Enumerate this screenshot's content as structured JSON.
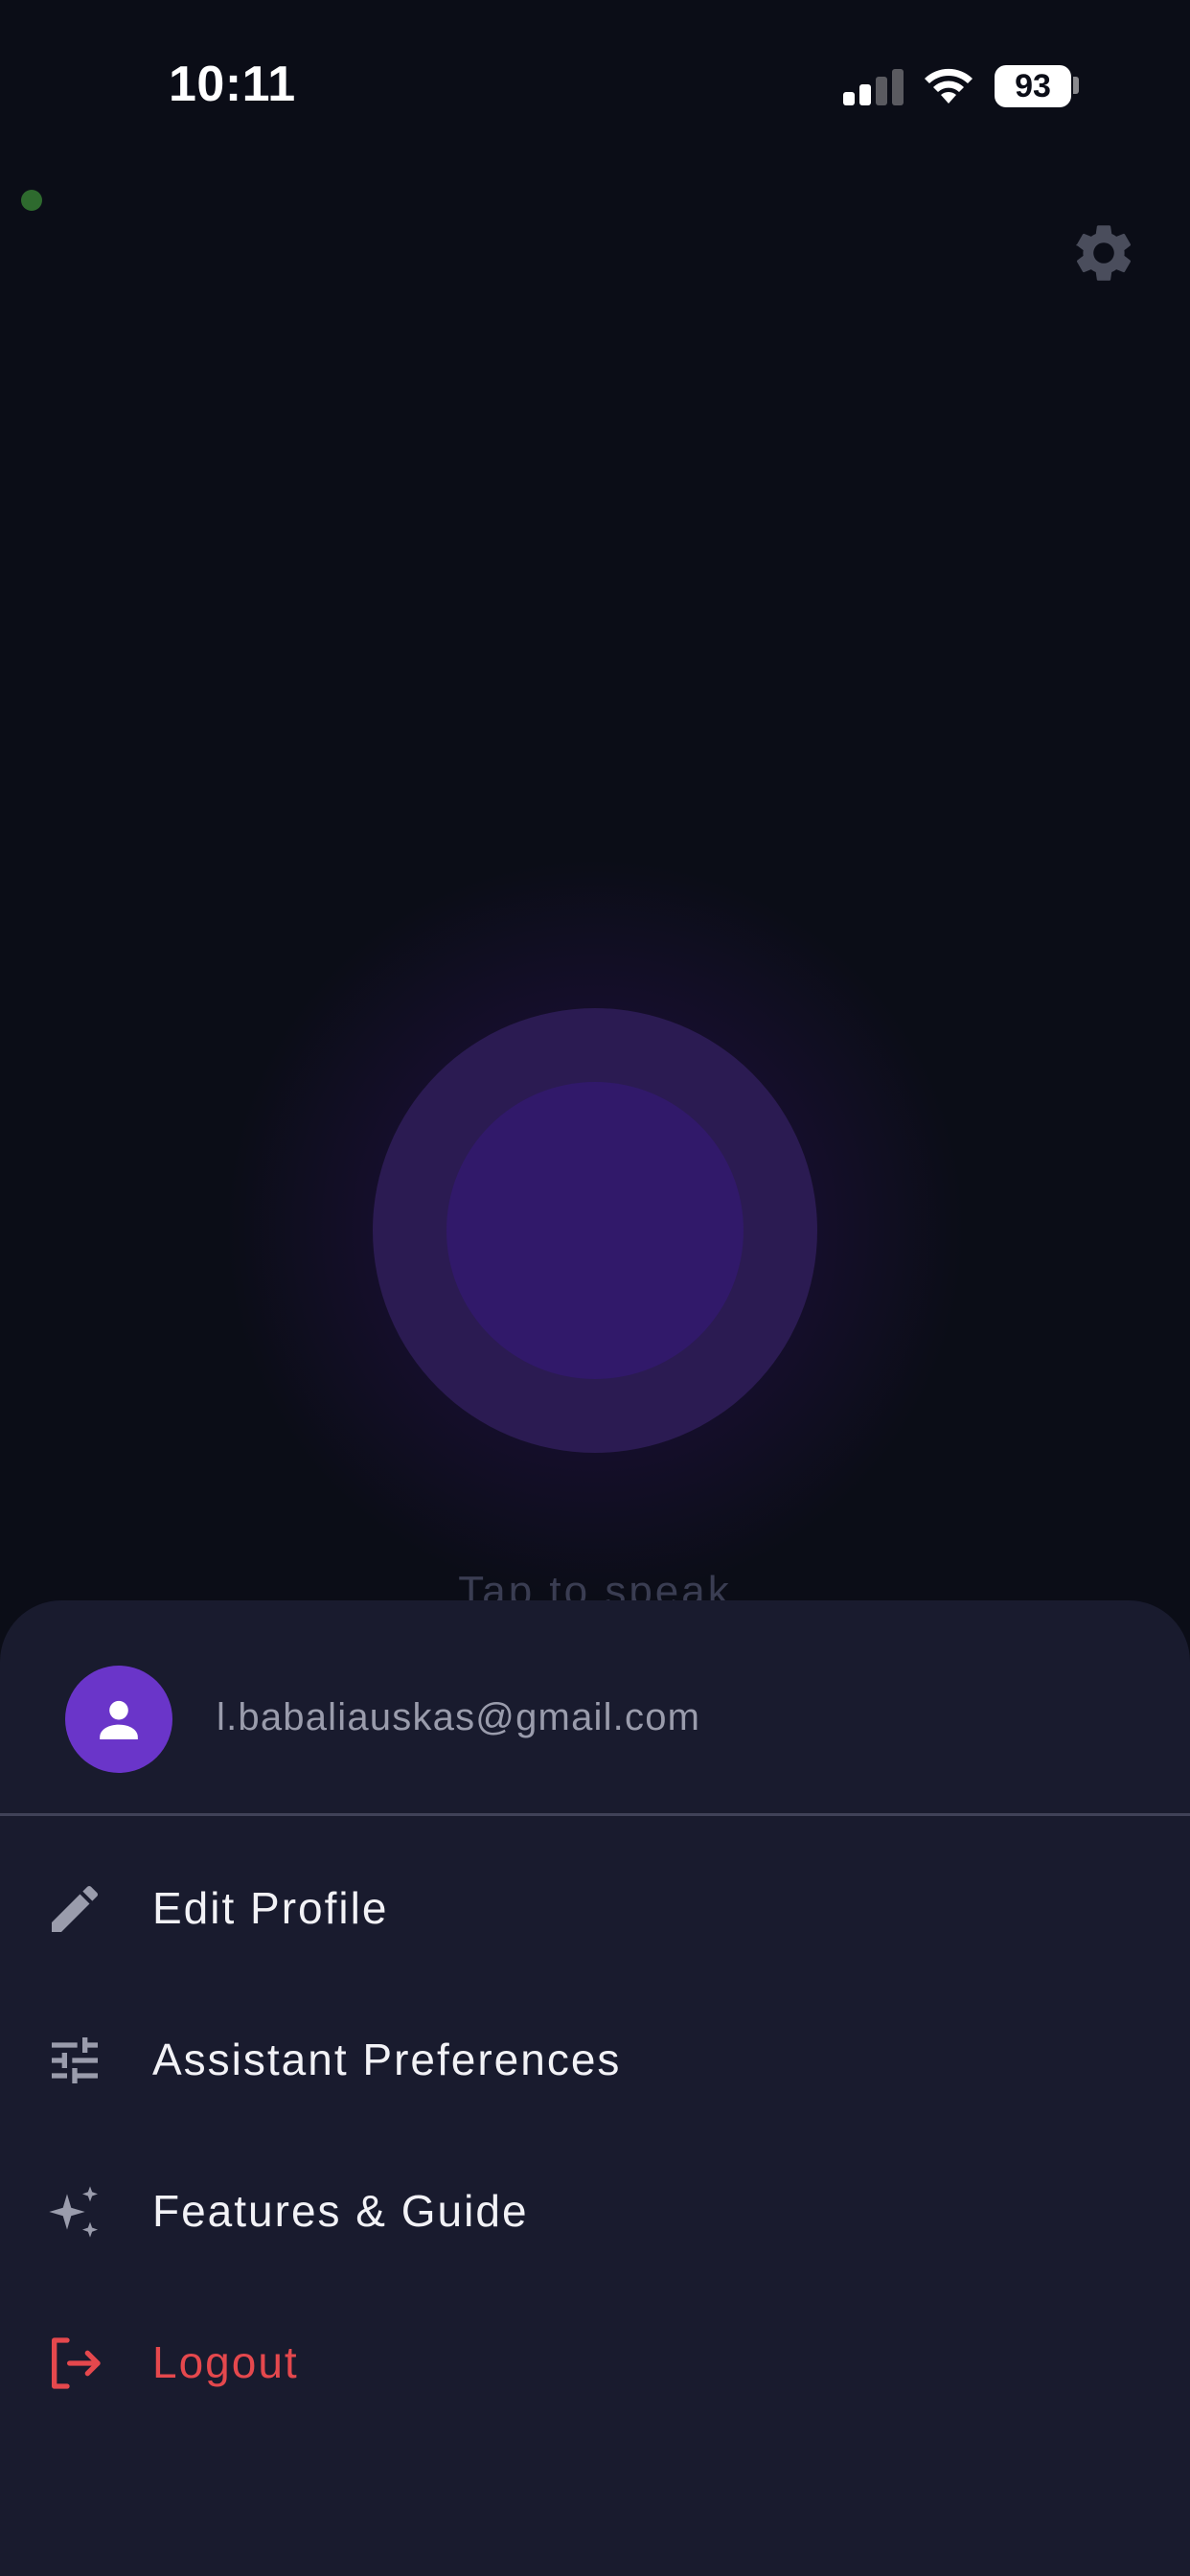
{
  "status_bar": {
    "time": "10:11",
    "battery": "93",
    "signal_icon": "cellular-signal-icon",
    "wifi_icon": "wifi-icon"
  },
  "header": {
    "settings_icon": "gear-icon",
    "status_dot_color": "#2e6a2e"
  },
  "voice": {
    "prompt": "Tap to speak",
    "orb_color": "#31196a"
  },
  "sheet": {
    "email": "l.babaliauskas@gmail.com",
    "avatar_icon": "person-icon",
    "avatar_color": "#6a35c9",
    "menu": [
      {
        "label": "Edit Profile",
        "icon": "pencil-icon"
      },
      {
        "label": "Assistant Preferences",
        "icon": "sliders-icon"
      },
      {
        "label": "Features & Guide",
        "icon": "sparkles-icon"
      },
      {
        "label": "Logout",
        "icon": "logout-icon",
        "color": "#e5484d"
      }
    ]
  }
}
